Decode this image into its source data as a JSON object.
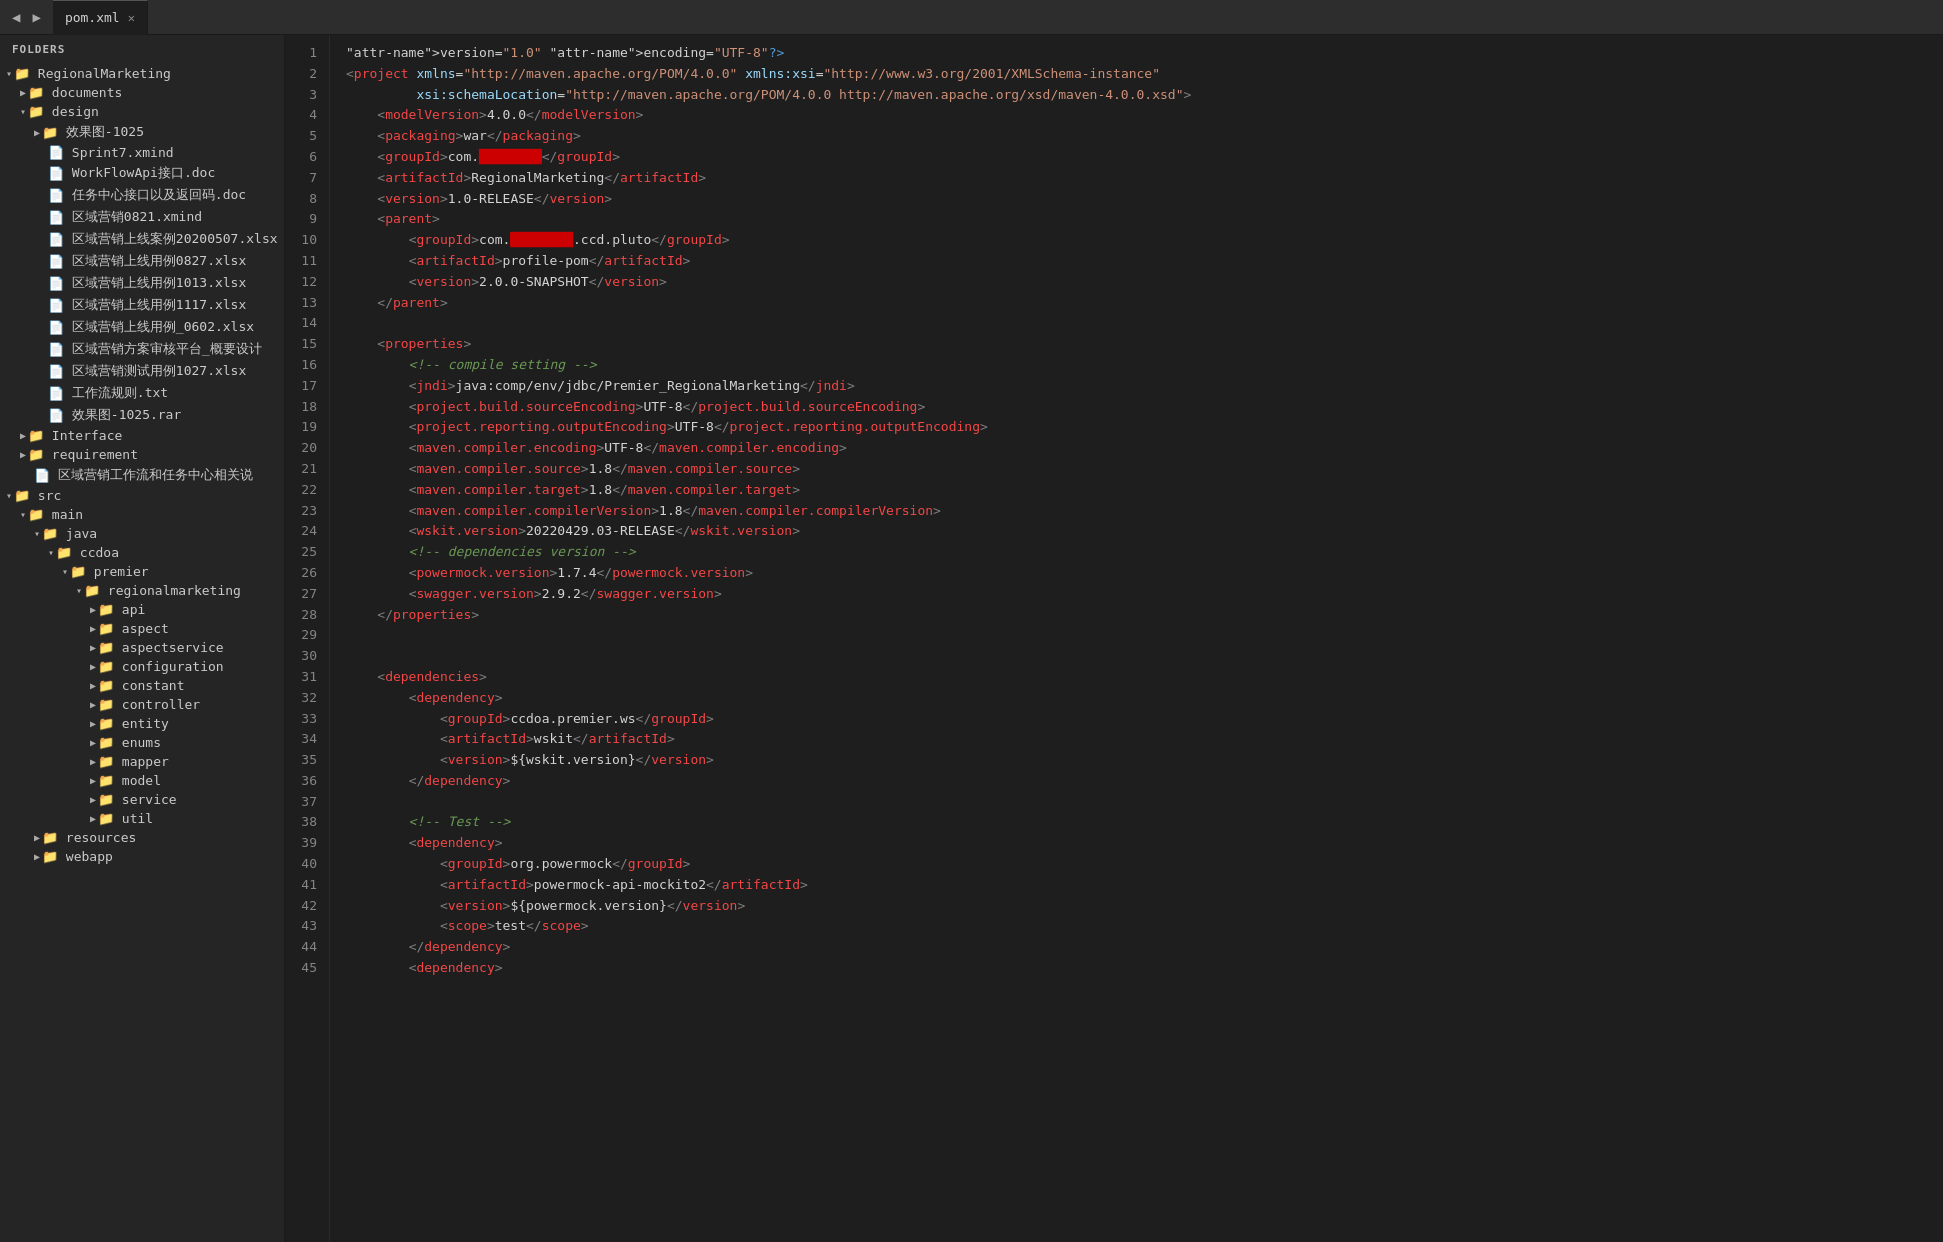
{
  "tabBar": {
    "filename": "pom.xml",
    "navPrev": "◀",
    "navNext": "▶"
  },
  "sidebar": {
    "header": "FOLDERS",
    "tree": [
      {
        "id": "regionalmarketing",
        "label": "RegionalMarketing",
        "type": "folder",
        "depth": 0,
        "expanded": true,
        "chevron": "▾"
      },
      {
        "id": "documents",
        "label": "documents",
        "type": "folder",
        "depth": 1,
        "expanded": false,
        "chevron": "▶"
      },
      {
        "id": "design",
        "label": "design",
        "type": "folder",
        "depth": 1,
        "expanded": true,
        "chevron": "▾"
      },
      {
        "id": "xiaoguo1025",
        "label": "效果图-1025",
        "type": "folder",
        "depth": 2,
        "expanded": false,
        "chevron": "▶"
      },
      {
        "id": "sprint7",
        "label": "Sprint7.xmind",
        "type": "file",
        "depth": 2,
        "icon": "📄"
      },
      {
        "id": "workflowapi",
        "label": "WorkFlowApi接口.doc",
        "type": "file",
        "depth": 2,
        "icon": "📄"
      },
      {
        "id": "renwuzhongxin",
        "label": "任务中心接口以及返回码.doc",
        "type": "file",
        "depth": 2,
        "icon": "📄"
      },
      {
        "id": "quyuyingsiao0821",
        "label": "区域营销0821.xmind",
        "type": "file",
        "depth": 2,
        "icon": "📄"
      },
      {
        "id": "quyuyingxiao20200507",
        "label": "区域营销上线案例20200507.xlsx",
        "type": "file",
        "depth": 2,
        "icon": "📄"
      },
      {
        "id": "quyuyingxiao0827",
        "label": "区域营销上线用例0827.xlsx",
        "type": "file",
        "depth": 2,
        "icon": "📄"
      },
      {
        "id": "quyuyingxiao1013",
        "label": "区域营销上线用例1013.xlsx",
        "type": "file",
        "depth": 2,
        "icon": "📄"
      },
      {
        "id": "quyuyingxiao1117",
        "label": "区域营销上线用例1117.xlsx",
        "type": "file",
        "depth": 2,
        "icon": "📄"
      },
      {
        "id": "quyuyingxiao0602",
        "label": "区域营销上线用例_0602.xlsx",
        "type": "file",
        "depth": 2,
        "icon": "📄"
      },
      {
        "id": "quyuyingxiaofangan",
        "label": "区域营销方案审核平台_概要设计",
        "type": "file",
        "depth": 2,
        "icon": "📄"
      },
      {
        "id": "quyuyingxiao1027",
        "label": "区域营销测试用例1027.xlsx",
        "type": "file",
        "depth": 2,
        "icon": "📄"
      },
      {
        "id": "gongzuoliuguize",
        "label": "工作流规则.txt",
        "type": "file",
        "depth": 2,
        "icon": "📄"
      },
      {
        "id": "xiaoguo1025rar",
        "label": "效果图-1025.rar",
        "type": "file",
        "depth": 2,
        "icon": "📄"
      },
      {
        "id": "interface",
        "label": "Interface",
        "type": "folder",
        "depth": 1,
        "expanded": false,
        "chevron": "▶"
      },
      {
        "id": "requirement",
        "label": "requirement",
        "type": "folder",
        "depth": 1,
        "expanded": false,
        "chevron": "▶"
      },
      {
        "id": "quyuyingxiaowork",
        "label": "区域营销工作流和任务中心相关说",
        "type": "file",
        "depth": 1,
        "icon": "📄"
      },
      {
        "id": "src",
        "label": "src",
        "type": "folder",
        "depth": 0,
        "expanded": true,
        "chevron": "▾"
      },
      {
        "id": "main",
        "label": "main",
        "type": "folder",
        "depth": 1,
        "expanded": true,
        "chevron": "▾"
      },
      {
        "id": "java",
        "label": "java",
        "type": "folder",
        "depth": 2,
        "expanded": true,
        "chevron": "▾"
      },
      {
        "id": "ccdoa",
        "label": "ccdoa",
        "type": "folder",
        "depth": 3,
        "expanded": true,
        "chevron": "▾"
      },
      {
        "id": "premier",
        "label": "premier",
        "type": "folder",
        "depth": 4,
        "expanded": true,
        "chevron": "▾"
      },
      {
        "id": "regionalmarketing2",
        "label": "regionalmarketing",
        "type": "folder",
        "depth": 5,
        "expanded": true,
        "chevron": "▾"
      },
      {
        "id": "api",
        "label": "api",
        "type": "folder",
        "depth": 6,
        "expanded": false,
        "chevron": "▶"
      },
      {
        "id": "aspect",
        "label": "aspect",
        "type": "folder",
        "depth": 6,
        "expanded": false,
        "chevron": "▶"
      },
      {
        "id": "aspectservice",
        "label": "aspectservice",
        "type": "folder",
        "depth": 6,
        "expanded": false,
        "chevron": "▶"
      },
      {
        "id": "configuration",
        "label": "configuration",
        "type": "folder",
        "depth": 6,
        "expanded": false,
        "chevron": "▶"
      },
      {
        "id": "constant",
        "label": "constant",
        "type": "folder",
        "depth": 6,
        "expanded": false,
        "chevron": "▶"
      },
      {
        "id": "controller",
        "label": "controller",
        "type": "folder",
        "depth": 6,
        "expanded": false,
        "chevron": "▶"
      },
      {
        "id": "entity",
        "label": "entity",
        "type": "folder",
        "depth": 6,
        "expanded": false,
        "chevron": "▶"
      },
      {
        "id": "enums",
        "label": "enums",
        "type": "folder",
        "depth": 6,
        "expanded": false,
        "chevron": "▶"
      },
      {
        "id": "mapper",
        "label": "mapper",
        "type": "folder",
        "depth": 6,
        "expanded": false,
        "chevron": "▶"
      },
      {
        "id": "model",
        "label": "model",
        "type": "folder",
        "depth": 6,
        "expanded": false,
        "chevron": "▶"
      },
      {
        "id": "service",
        "label": "service",
        "type": "folder",
        "depth": 6,
        "expanded": false,
        "chevron": "▶"
      },
      {
        "id": "util",
        "label": "util",
        "type": "folder",
        "depth": 6,
        "expanded": false,
        "chevron": "▶"
      },
      {
        "id": "resources",
        "label": "resources",
        "type": "folder",
        "depth": 2,
        "expanded": false,
        "chevron": "▶"
      },
      {
        "id": "webapp",
        "label": "webapp",
        "type": "folder",
        "depth": 2,
        "expanded": false,
        "chevron": "▶"
      }
    ]
  },
  "editor": {
    "lines": [
      {
        "num": 1,
        "content": "<?xml version=\"1.0\" encoding=\"UTF-8\"?>"
      },
      {
        "num": 2,
        "content": "<project xmlns=\"http://maven.apache.org/POM/4.0.0\" xmlns:xsi=\"http://www.w3.org/2001/XMLSchema-instance\""
      },
      {
        "num": 3,
        "content": "         xsi:schemaLocation=\"http://maven.apache.org/POM/4.0.0 http://maven.apache.org/xsd/maven-4.0.0.xsd\">"
      },
      {
        "num": 4,
        "content": "    <modelVersion>4.0.0</modelVersion>"
      },
      {
        "num": 5,
        "content": "    <packaging>war</packaging>"
      },
      {
        "num": 6,
        "content": "    <groupId>com.████████</groupId>"
      },
      {
        "num": 7,
        "content": "    <artifactId>RegionalMarketing</artifactId>"
      },
      {
        "num": 8,
        "content": "    <version>1.0-RELEASE</version>"
      },
      {
        "num": 9,
        "content": "    <parent>"
      },
      {
        "num": 10,
        "content": "        <groupId>com.████████.ccd.pluto</groupId>"
      },
      {
        "num": 11,
        "content": "        <artifactId>profile-pom</artifactId>"
      },
      {
        "num": 12,
        "content": "        <version>2.0.0-SNAPSHOT</version>"
      },
      {
        "num": 13,
        "content": "    </parent>"
      },
      {
        "num": 14,
        "content": ""
      },
      {
        "num": 15,
        "content": "    <properties>"
      },
      {
        "num": 16,
        "content": "        <!-- compile setting -->"
      },
      {
        "num": 17,
        "content": "        <jndi>java:comp/env/jdbc/Premier_RegionalMarketing</jndi>"
      },
      {
        "num": 18,
        "content": "        <project.build.sourceEncoding>UTF-8</project.build.sourceEncoding>"
      },
      {
        "num": 19,
        "content": "        <project.reporting.outputEncoding>UTF-8</project.reporting.outputEncoding>"
      },
      {
        "num": 20,
        "content": "        <maven.compiler.encoding>UTF-8</maven.compiler.encoding>"
      },
      {
        "num": 21,
        "content": "        <maven.compiler.source>1.8</maven.compiler.source>"
      },
      {
        "num": 22,
        "content": "        <maven.compiler.target>1.8</maven.compiler.target>"
      },
      {
        "num": 23,
        "content": "        <maven.compiler.compilerVersion>1.8</maven.compiler.compilerVersion>"
      },
      {
        "num": 24,
        "content": "        <wskit.version>20220429.03-RELEASE</wskit.version>"
      },
      {
        "num": 25,
        "content": "        <!-- dependencies version -->"
      },
      {
        "num": 26,
        "content": "        <powermock.version>1.7.4</powermock.version>"
      },
      {
        "num": 27,
        "content": "        <swagger.version>2.9.2</swagger.version>"
      },
      {
        "num": 28,
        "content": "    </properties>"
      },
      {
        "num": 29,
        "content": ""
      },
      {
        "num": 30,
        "content": ""
      },
      {
        "num": 31,
        "content": "    <dependencies>"
      },
      {
        "num": 32,
        "content": "        <dependency>"
      },
      {
        "num": 33,
        "content": "            <groupId>ccdoa.premier.ws</groupId>"
      },
      {
        "num": 34,
        "content": "            <artifactId>wskit</artifactId>"
      },
      {
        "num": 35,
        "content": "            <version>${wskit.version}</version>"
      },
      {
        "num": 36,
        "content": "        </dependency>"
      },
      {
        "num": 37,
        "content": ""
      },
      {
        "num": 38,
        "content": "        <!-- Test -->"
      },
      {
        "num": 39,
        "content": "        <dependency>"
      },
      {
        "num": 40,
        "content": "            <groupId>org.powermock</groupId>"
      },
      {
        "num": 41,
        "content": "            <artifactId>powermock-api-mockito2</artifactId>"
      },
      {
        "num": 42,
        "content": "            <version>${powermock.version}</version>"
      },
      {
        "num": 43,
        "content": "            <scope>test</scope>"
      },
      {
        "num": 44,
        "content": "        </dependency>"
      },
      {
        "num": 45,
        "content": "        <dependency>"
      }
    ]
  }
}
